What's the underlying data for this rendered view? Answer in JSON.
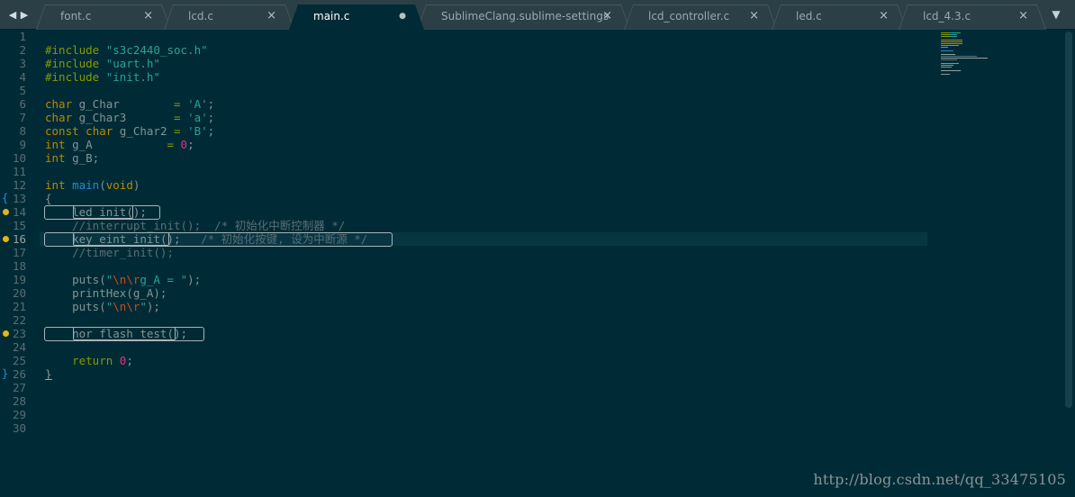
{
  "tabs": [
    {
      "label": "font.c",
      "active": false
    },
    {
      "label": "lcd.c",
      "active": false
    },
    {
      "label": "main.c",
      "active": true
    },
    {
      "label": "SublimeClang.sublime-settings",
      "active": false
    },
    {
      "label": "lcd_controller.c",
      "active": false
    },
    {
      "label": "led.c",
      "active": false
    },
    {
      "label": "lcd_4.3.c",
      "active": false
    }
  ],
  "tab_close_glyph": "×",
  "tab_modified_glyph": "●",
  "nav": {
    "left": "◀",
    "right": "▶",
    "dropdown": "▼"
  },
  "line_numbers": [
    "1",
    "2",
    "3",
    "4",
    "5",
    "6",
    "7",
    "8",
    "9",
    "10",
    "11",
    "12",
    "13",
    "14",
    "15",
    "16",
    "17",
    "18",
    "19",
    "20",
    "21",
    "22",
    "23",
    "24",
    "25",
    "26",
    "27",
    "28",
    "29",
    "30"
  ],
  "current_line": 16,
  "gutter_markers": {
    "warning_lines": [
      14,
      16,
      23
    ],
    "fold_open_line": 13,
    "fold_close_line": 26
  },
  "code": {
    "l2a": "#include ",
    "l2b": "\"s3c2440_soc.h\"",
    "l3a": "#include ",
    "l3b": "\"uart.h\"",
    "l4a": "#include ",
    "l4b": "\"init.h\"",
    "l6a": "char",
    "l6b": " g_Char        ",
    "l6c": "=",
    "l6d": " ",
    "l6e": "'A'",
    "l6f": ";",
    "l7a": "char",
    "l7b": " g_Char3       ",
    "l7c": "=",
    "l7d": " ",
    "l7e": "'a'",
    "l7f": ";",
    "l8a": "const",
    "l8b": " ",
    "l8c": "char",
    "l8d": " g_Char2 ",
    "l8e": "=",
    "l8f": " ",
    "l8g": "'B'",
    "l8h": ";",
    "l9a": "int",
    "l9b": " g_A           ",
    "l9c": "=",
    "l9d": " ",
    "l9e": "0",
    "l9f": ";",
    "l10a": "int",
    "l10b": " g_B;",
    "l12a": "int",
    "l12b": " ",
    "l12c": "main",
    "l12d": "(",
    "l12e": "void",
    "l12f": ")",
    "l13": "{",
    "l14a": "    led_init",
    "l14b": "();",
    "l15": "    //interrupt_init();  /* 初始化中断控制器 */",
    "l16a": "    key_eint_init",
    "l16b": "();   ",
    "l16c": "/* 初始化按键, 设为中断源 */",
    "l17": "    //timer_init();",
    "l19a": "    puts(",
    "l19b": "\"",
    "l19c": "\\n\\r",
    "l19d": "g_A = \"",
    "l19e": ");",
    "l20": "    printHex(g_A);",
    "l21a": "    puts(",
    "l21b": "\"",
    "l21c": "\\n\\r",
    "l21d": "\"",
    "l21e": ");",
    "l23a": "    nor_flash_test",
    "l23b": "();",
    "l25a": "    ",
    "l25b": "return",
    "l25c": " ",
    "l25d": "0",
    "l25e": ";",
    "l26": "}"
  },
  "watermark": "http://blog.csdn.net/qq_33475105"
}
